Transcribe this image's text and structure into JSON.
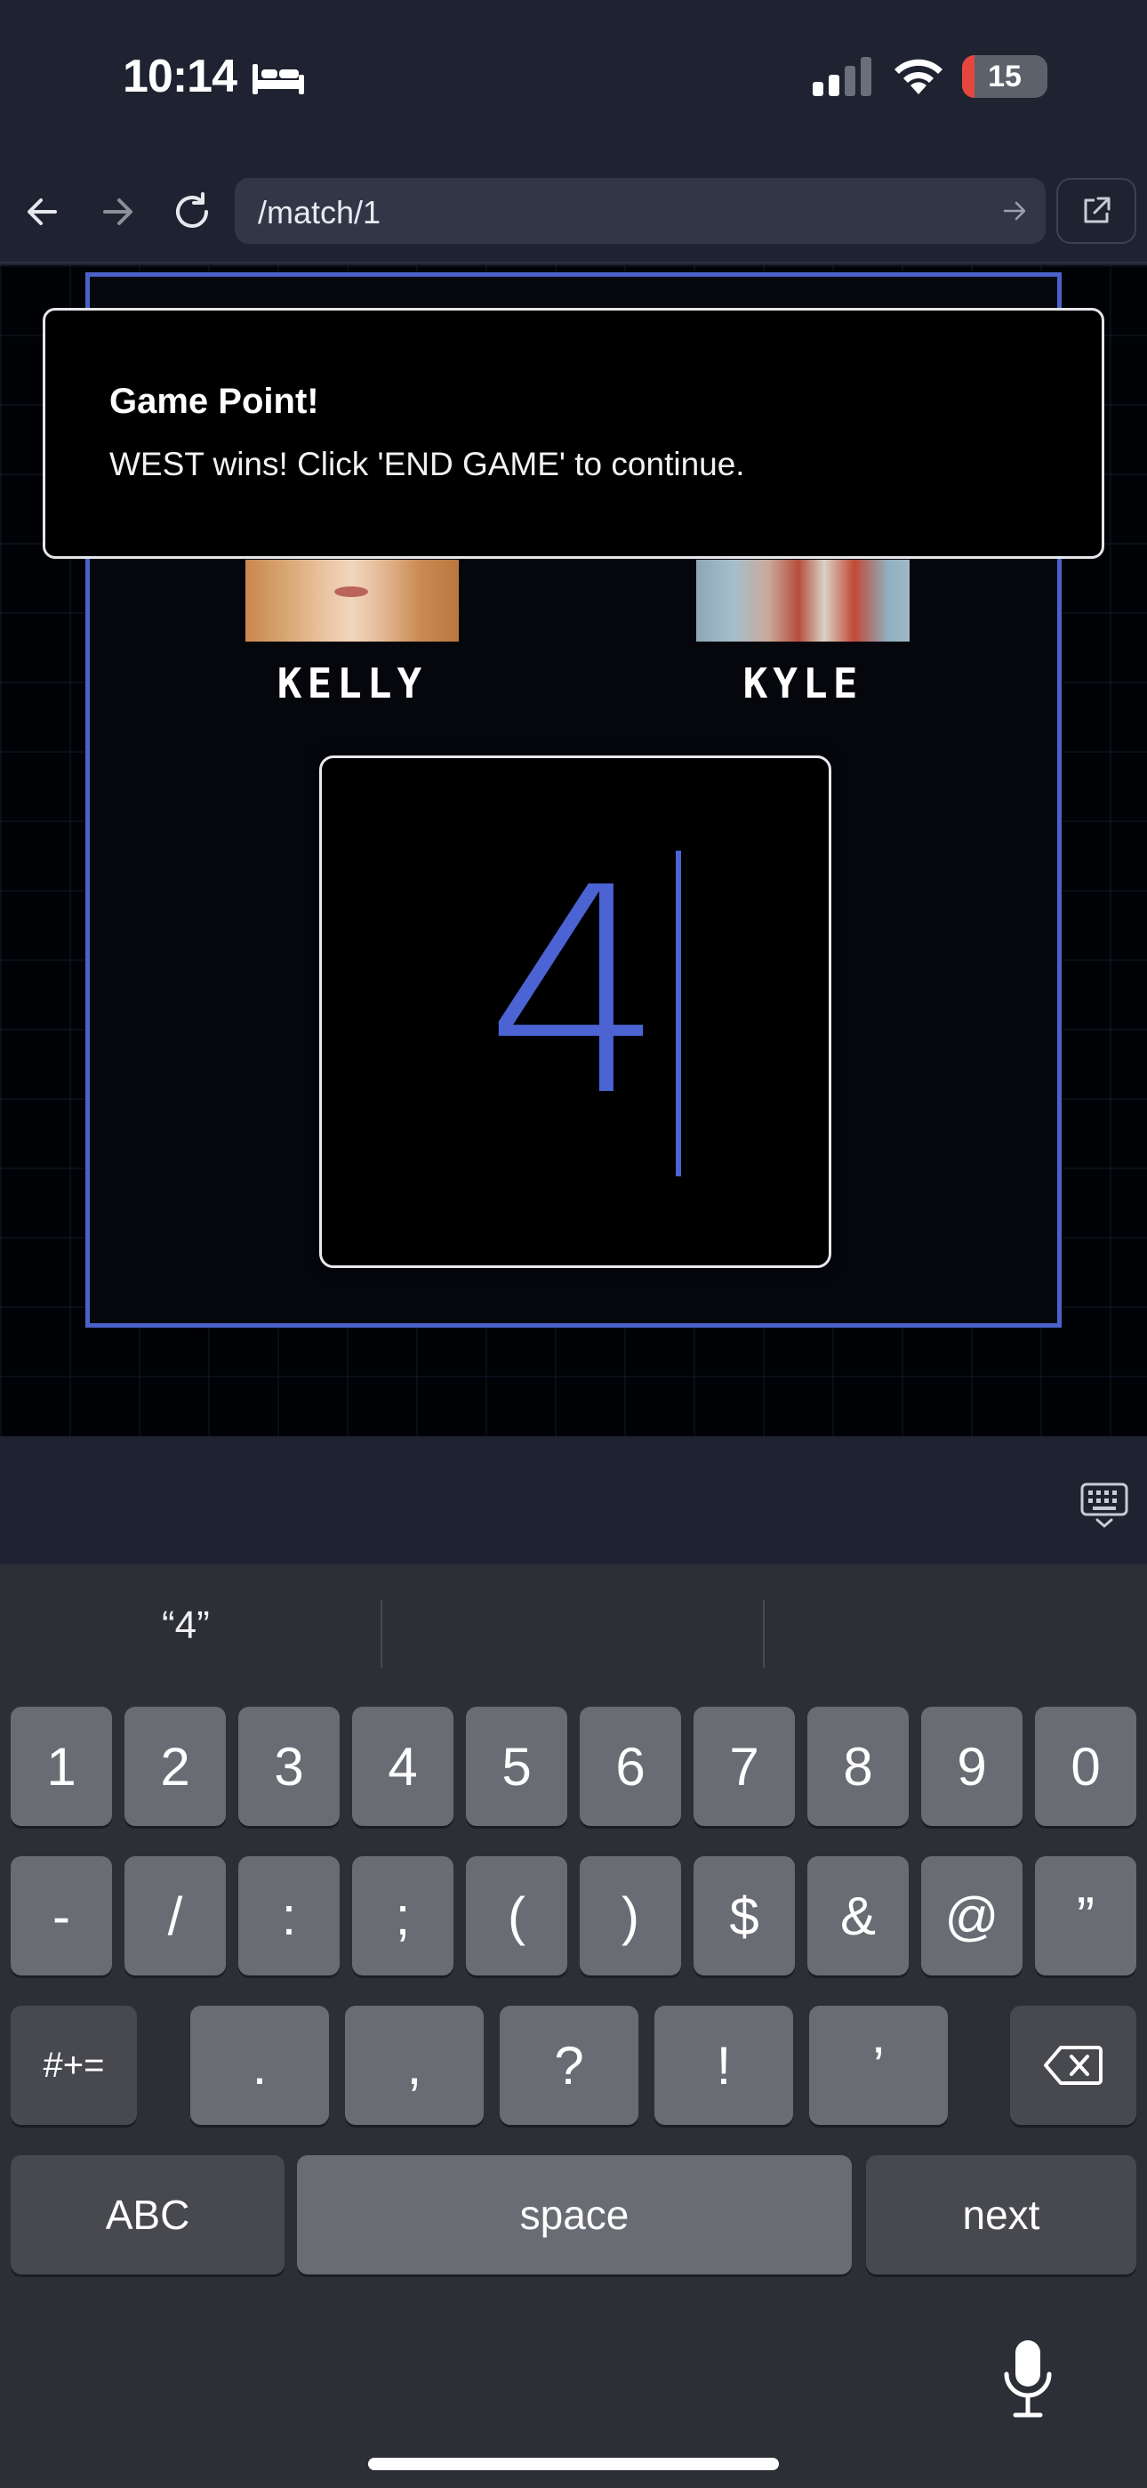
{
  "status_bar": {
    "time": "10:14",
    "sleep_icon": "bed-icon",
    "battery_level": "15",
    "battery_fraction": 0.15,
    "battery_color": "#e5473f"
  },
  "browser": {
    "url": "/match/1",
    "back_icon": "arrow-left-icon",
    "forward_icon": "arrow-right-icon",
    "reload_icon": "reload-icon",
    "external_icon": "external-link-icon"
  },
  "game": {
    "players": [
      {
        "name": "KELLY"
      },
      {
        "name": "KYLE"
      }
    ],
    "score_input_value": "4",
    "accent_color": "#4a62c9"
  },
  "toast": {
    "title": "Game Point!",
    "message": "WEST wins! Click 'END GAME' to continue."
  },
  "keyboard": {
    "suggestions": [
      "“4”",
      "",
      ""
    ],
    "row1": [
      "1",
      "2",
      "3",
      "4",
      "5",
      "6",
      "7",
      "8",
      "9",
      "0"
    ],
    "row2": [
      "-",
      "/",
      ":",
      ";",
      "(",
      ")",
      "$",
      "&",
      "@",
      "”"
    ],
    "row3_left": "#+=",
    "row3": [
      ".",
      ",",
      "?",
      "!",
      "’"
    ],
    "delete_icon": "backspace-icon",
    "abc_label": "ABC",
    "space_label": "space",
    "next_label": "next",
    "mic_icon": "microphone-icon"
  }
}
